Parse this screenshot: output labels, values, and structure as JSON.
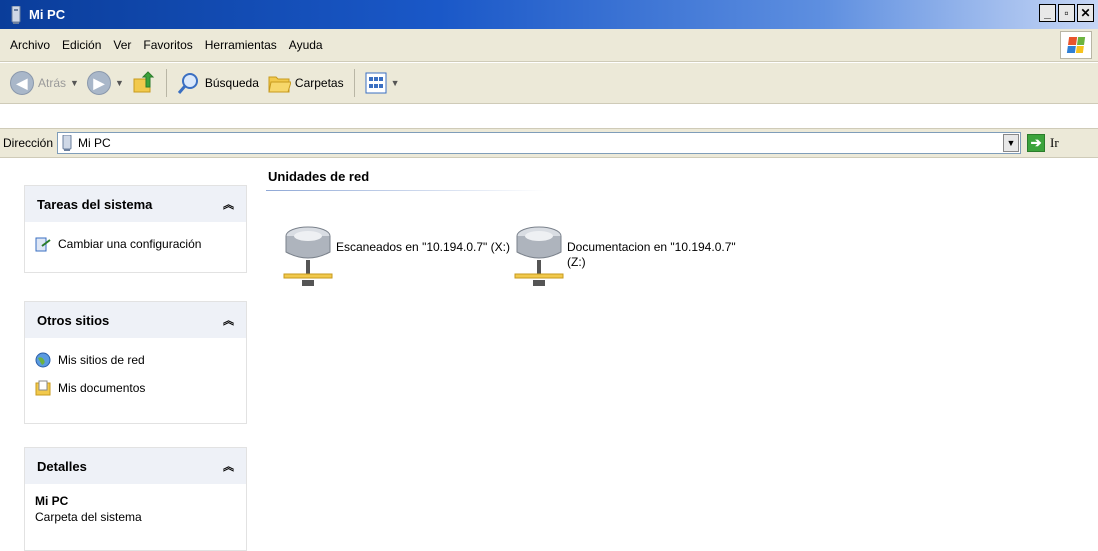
{
  "window": {
    "title": "Mi PC"
  },
  "menu": {
    "items": [
      "Archivo",
      "Edición",
      "Ver",
      "Favoritos",
      "Herramientas",
      "Ayuda"
    ]
  },
  "toolbar": {
    "back_label": "Atrás",
    "search_label": "Búsqueda",
    "folders_label": "Carpetas"
  },
  "address": {
    "label": "Dirección",
    "value": "Mi PC",
    "go_label": "Ir"
  },
  "panels": {
    "system_tasks": {
      "title": "Tareas del sistema",
      "items": [
        "Cambiar una configuración"
      ]
    },
    "other_places": {
      "title": "Otros sitios",
      "items": [
        "Mis sitios de red",
        "Mis documentos"
      ]
    },
    "details": {
      "title": "Detalles",
      "name": "Mi PC",
      "subtitle": "Carpeta del sistema"
    }
  },
  "content": {
    "group_title": "Unidades de red",
    "drives": [
      {
        "label": "Escaneados en \"10.194.0.7\" (X:)"
      },
      {
        "label_line1": "Documentacion en \"10.194.0.7\"",
        "label_line2": "(Z:)"
      }
    ]
  },
  "colors": {
    "title_bar": "#1a58c8",
    "toolbar_bg": "#ece9d8",
    "panel_header": "#eef1f7"
  }
}
